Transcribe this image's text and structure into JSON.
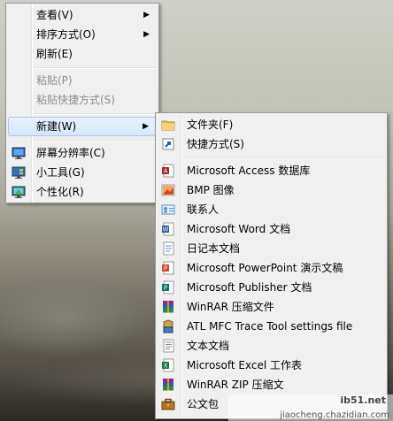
{
  "context_menu": {
    "items": [
      {
        "label": "查看(V)"
      },
      {
        "label": "排序方式(O)"
      },
      {
        "label": "刷新(E)"
      },
      {
        "label": "粘贴(P)"
      },
      {
        "label": "粘贴快捷方式(S)"
      },
      {
        "label": "新建(W)"
      },
      {
        "label": "屏幕分辨率(C)"
      },
      {
        "label": "小工具(G)"
      },
      {
        "label": "个性化(R)"
      }
    ],
    "submenu_arrow": "▶"
  },
  "new_submenu": {
    "items": [
      {
        "label": "文件夹(F)",
        "icon": "folder-icon"
      },
      {
        "label": "快捷方式(S)",
        "icon": "shortcut-icon"
      },
      {
        "label": "Microsoft Access 数据库",
        "icon": "access-icon"
      },
      {
        "label": "BMP 图像",
        "icon": "bmp-image-icon"
      },
      {
        "label": "联系人",
        "icon": "contact-icon"
      },
      {
        "label": "Microsoft Word 文档",
        "icon": "word-icon"
      },
      {
        "label": "日记本文档",
        "icon": "journal-icon"
      },
      {
        "label": "Microsoft PowerPoint 演示文稿",
        "icon": "powerpoint-icon"
      },
      {
        "label": "Microsoft Publisher 文档",
        "icon": "publisher-icon"
      },
      {
        "label": "WinRAR 压缩文件",
        "icon": "winrar-icon"
      },
      {
        "label": "ATL MFC Trace Tool settings file",
        "icon": "trace-tool-icon"
      },
      {
        "label": "文本文档",
        "icon": "text-document-icon"
      },
      {
        "label": "Microsoft Excel 工作表",
        "icon": "excel-icon"
      },
      {
        "label": "WinRAR ZIP 压缩文",
        "icon": "winrar-zip-icon"
      },
      {
        "label": "公文包",
        "icon": "briefcase-icon"
      }
    ]
  },
  "watermark": {
    "line1": "ib51.net",
    "line2": "jiaocheng.chazidian.com"
  }
}
